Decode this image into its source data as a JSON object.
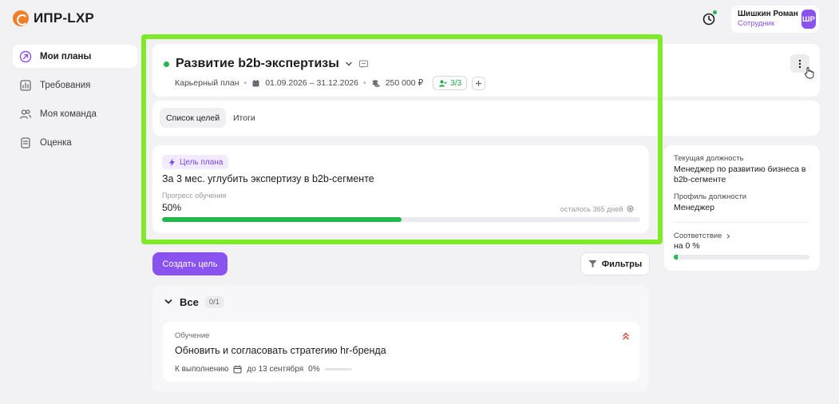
{
  "app": {
    "name": "ИПР-LXP",
    "brand_color": "#f07f2a",
    "accent_color": "#8a52ee",
    "success_color": "#22b84c"
  },
  "header": {
    "history_icon": "history-icon",
    "user": {
      "name": "Шишкин Роман",
      "role": "Сотрудник",
      "initials": "ШР"
    }
  },
  "sidebar": {
    "items": [
      {
        "label": "Мои планы",
        "icon": "plans-icon",
        "active": true
      },
      {
        "label": "Требования",
        "icon": "requirements-icon",
        "active": false
      },
      {
        "label": "Моя команда",
        "icon": "team-icon",
        "active": false
      },
      {
        "label": "Оценка",
        "icon": "evaluation-icon",
        "active": false
      }
    ]
  },
  "plan": {
    "title": "Развитие b2b-экспертизы",
    "type": "Карьерный план",
    "period": "01.09.2026 – 31.12.2026",
    "budget": "250 000 ₽",
    "participants": "3/3"
  },
  "tabs": [
    {
      "label": "Список целей",
      "active": true
    },
    {
      "label": "Итоги",
      "active": false
    }
  ],
  "goal": {
    "tag": "Цель плана",
    "text": "За 3 мес. углубить экспертизу в b2b-сегменте",
    "progress_label": "Прогресс обучения",
    "progress_value": "50%",
    "progress_fraction": 0.5,
    "remaining": "осталось 365 дней"
  },
  "info": {
    "position_label": "Текущая должность",
    "position_value": "Менеджер по развитию бизнеса в b2b-сегменте",
    "profile_label": "Профиль должности",
    "profile_value": "Менеджер",
    "match_label": "Соответствие",
    "match_value": "на 0 %",
    "match_fraction": 0
  },
  "actions": {
    "create_goal": "Создать цель",
    "filters": "Фильтры"
  },
  "goals_list": {
    "title": "Все",
    "count": "0/1",
    "items": [
      {
        "category": "Обучение",
        "title": "Обновить и согласовать стратегию hr-бренда",
        "status": "К выполнению",
        "deadline": "до 13 сентября",
        "progress": "0%"
      }
    ]
  }
}
